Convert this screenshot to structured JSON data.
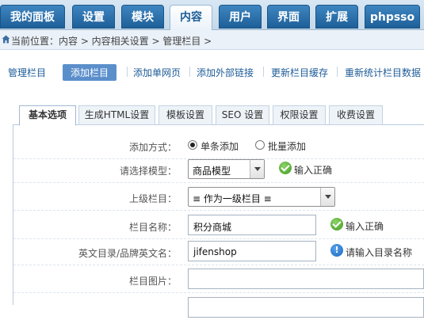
{
  "topnav": {
    "tabs": [
      {
        "label": "我的面板"
      },
      {
        "label": "设置"
      },
      {
        "label": "模块"
      },
      {
        "label": "内容",
        "active": true
      },
      {
        "label": "用户"
      },
      {
        "label": "界面"
      },
      {
        "label": "扩展"
      },
      {
        "label": "phpsso"
      }
    ]
  },
  "breadcrumb": {
    "text": "当前位置：内容 > 内容相关设置 > 管理栏目 >"
  },
  "subnav": {
    "items": [
      {
        "label": "管理栏目"
      },
      {
        "label": "添加栏目",
        "active": true
      },
      {
        "label": "添加单网页"
      },
      {
        "label": "添加外部链接"
      },
      {
        "label": "更新栏目缓存"
      },
      {
        "label": "重新统计栏目数据"
      }
    ]
  },
  "tabs": [
    {
      "label": "基本选项",
      "active": true
    },
    {
      "label": "生成HTML设置"
    },
    {
      "label": "模板设置"
    },
    {
      "label": "SEO 设置"
    },
    {
      "label": "权限设置"
    },
    {
      "label": "收费设置"
    }
  ],
  "form": {
    "add_mode": {
      "label": "添加方式：",
      "options": [
        "单条添加",
        "批量添加"
      ],
      "selected": "单条添加"
    },
    "model": {
      "label": "请选择模型：",
      "value": "商品模型",
      "status": "输入正确"
    },
    "parent": {
      "label": "上级栏目：",
      "value": "≡ 作为一级栏目 ≡"
    },
    "catname": {
      "label": "栏目名称：",
      "value": "积分商城",
      "status": "输入正确"
    },
    "catdir": {
      "label": "英文目录/品牌英文名：",
      "value": "jifenshop",
      "status": "请输入目录名称"
    },
    "image": {
      "label": "栏目图片：",
      "value": ""
    }
  },
  "colors": {
    "nav_blue": "#1e5f98",
    "link_blue": "#1d5b97",
    "active_sub": "#5b8fcb",
    "ok_green": "#3c9b1e",
    "info_blue": "#1868be"
  }
}
